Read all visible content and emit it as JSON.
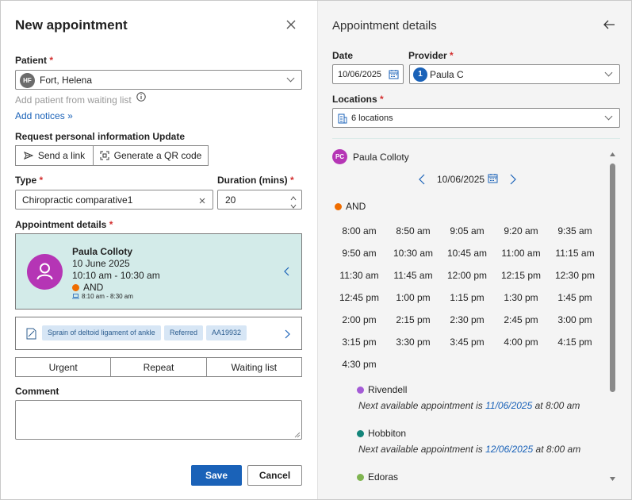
{
  "left": {
    "title": "New appointment",
    "patient": {
      "label": "Patient",
      "required": "*",
      "initials": "HF",
      "value": "Fort, Helena",
      "waiting_list_hint": "Add patient from waiting list",
      "add_notices": "Add notices"
    },
    "request_info": {
      "label": "Request personal information Update",
      "send_link": "Send a link",
      "qr_code": "Generate a QR code"
    },
    "type": {
      "label": "Type",
      "required": "*",
      "value": "Chiropractic comparative1"
    },
    "duration": {
      "label": "Duration (mins)",
      "required": "*",
      "value": "20"
    },
    "appointment_details": {
      "label": "Appointment details",
      "required": "*",
      "provider_name": "Paula Colloty",
      "date": "10 June 2025",
      "time": "10:10 am - 10:30 am",
      "location": "AND",
      "sub_time": "8:10 am - 8:30 am"
    },
    "tags": [
      "Sprain of deltoid ligament of ankle",
      "Referred",
      "AA19932"
    ],
    "options": [
      "Urgent",
      "Repeat",
      "Waiting list"
    ],
    "comment": {
      "label": "Comment",
      "value": ""
    },
    "save": "Save",
    "cancel": "Cancel"
  },
  "right": {
    "title": "Appointment details",
    "date": {
      "label": "Date",
      "value": "10/06/2025"
    },
    "provider": {
      "label": "Provider",
      "required": "*",
      "badge": "1",
      "value": "Paula C"
    },
    "locations": {
      "label": "Locations",
      "required": "*",
      "value": "6 locations"
    },
    "provider_block": {
      "initials": "PC",
      "name": "Paula Colloty",
      "nav_date": "10/06/2025",
      "location": "AND",
      "slots": [
        "8:00 am",
        "8:50 am",
        "9:05 am",
        "9:20 am",
        "9:35 am",
        "9:50 am",
        "10:30 am",
        "10:45 am",
        "11:00 am",
        "11:15 am",
        "11:30 am",
        "11:45 am",
        "12:00 pm",
        "12:15 pm",
        "12:30 pm",
        "12:45 pm",
        "1:00 pm",
        "1:15 pm",
        "1:30 pm",
        "1:45 pm",
        "2:00 pm",
        "2:15 pm",
        "2:30 pm",
        "2:45 pm",
        "3:00 pm",
        "3:15 pm",
        "3:30 pm",
        "3:45 pm",
        "4:00 pm",
        "4:15 pm",
        "4:30 pm"
      ]
    },
    "other_locations": [
      {
        "name": "Rivendell",
        "color": "#a45bd6",
        "prefix": "Next available appointment is",
        "date": "11/06/2025",
        "suffix": "at 8:00 am"
      },
      {
        "name": "Hobbiton",
        "color": "#13857a",
        "prefix": "Next available appointment is",
        "date": "12/06/2025",
        "suffix": "at 8:00 am"
      },
      {
        "name": "Edoras",
        "color": "#7fb450"
      }
    ]
  },
  "colors": {
    "accent": "#1a62b8",
    "avatar_purple": "#b535b5",
    "selected_bg": "#d3ebe9",
    "location_orange": "#ef6c00"
  }
}
